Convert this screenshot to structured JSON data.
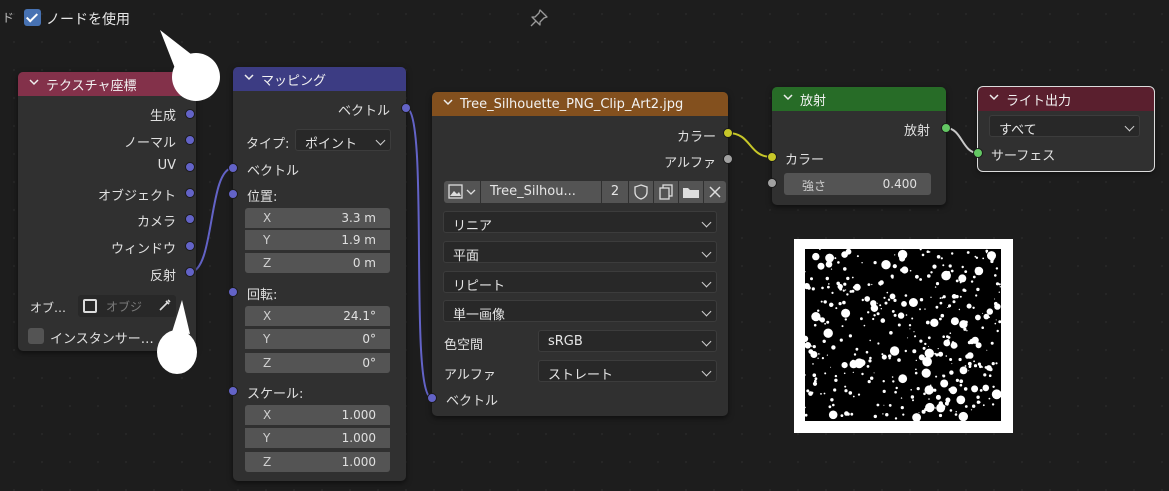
{
  "header": {
    "edge_glyph": "ド",
    "use_nodes_label": "ノードを使用",
    "use_nodes_checked": true
  },
  "nodes": {
    "texcoord": {
      "title": "テクスチャ座標",
      "color": "#83314a",
      "outputs": [
        "生成",
        "ノーマル",
        "UV",
        "オブジェクト",
        "カメラ",
        "ウィンドウ",
        "反射"
      ],
      "object_label": "オブ…",
      "object_placeholder": "オブジ",
      "instancer_label": "インスタンサー…"
    },
    "mapping": {
      "title": "マッピング",
      "color": "#3c3c83",
      "output": "ベクトル",
      "type_label": "タイプ:",
      "type_value": "ポイント",
      "vector_input": "ベクトル",
      "location_label": "位置:",
      "location": [
        {
          "axis": "X",
          "value": "3.3 m"
        },
        {
          "axis": "Y",
          "value": "1.9 m"
        },
        {
          "axis": "Z",
          "value": "0 m"
        }
      ],
      "rotation_label": "回転:",
      "rotation": [
        {
          "axis": "X",
          "value": "24.1°"
        },
        {
          "axis": "Y",
          "value": "0°"
        },
        {
          "axis": "Z",
          "value": "0°"
        }
      ],
      "scale_label": "スケール:",
      "scale": [
        {
          "axis": "X",
          "value": "1.000"
        },
        {
          "axis": "Y",
          "value": "1.000"
        },
        {
          "axis": "Z",
          "value": "1.000"
        }
      ]
    },
    "image": {
      "title": "Tree_Silhouette_PNG_Clip_Art2.jpg",
      "color": "#83501e",
      "out_color": "カラー",
      "out_alpha": "アルファ",
      "image_name": "Tree_Silhou...",
      "users": "2",
      "interpolation": "リニア",
      "projection": "平面",
      "extension": "リピート",
      "source": "単一画像",
      "colorspace_label": "色空間",
      "colorspace": "sRGB",
      "alpha_label": "アルファ",
      "alpha_mode": "ストレート",
      "vector_input": "ベクトル"
    },
    "emission": {
      "title": "放射",
      "color": "#276c27",
      "output": "放射",
      "color_input": "カラー",
      "strength_label": "強さ",
      "strength_value": "0.400"
    },
    "light_output": {
      "title": "ライト出力",
      "color": "#5a1f2e",
      "target": "すべて",
      "surface_input": "サーフェス"
    }
  }
}
